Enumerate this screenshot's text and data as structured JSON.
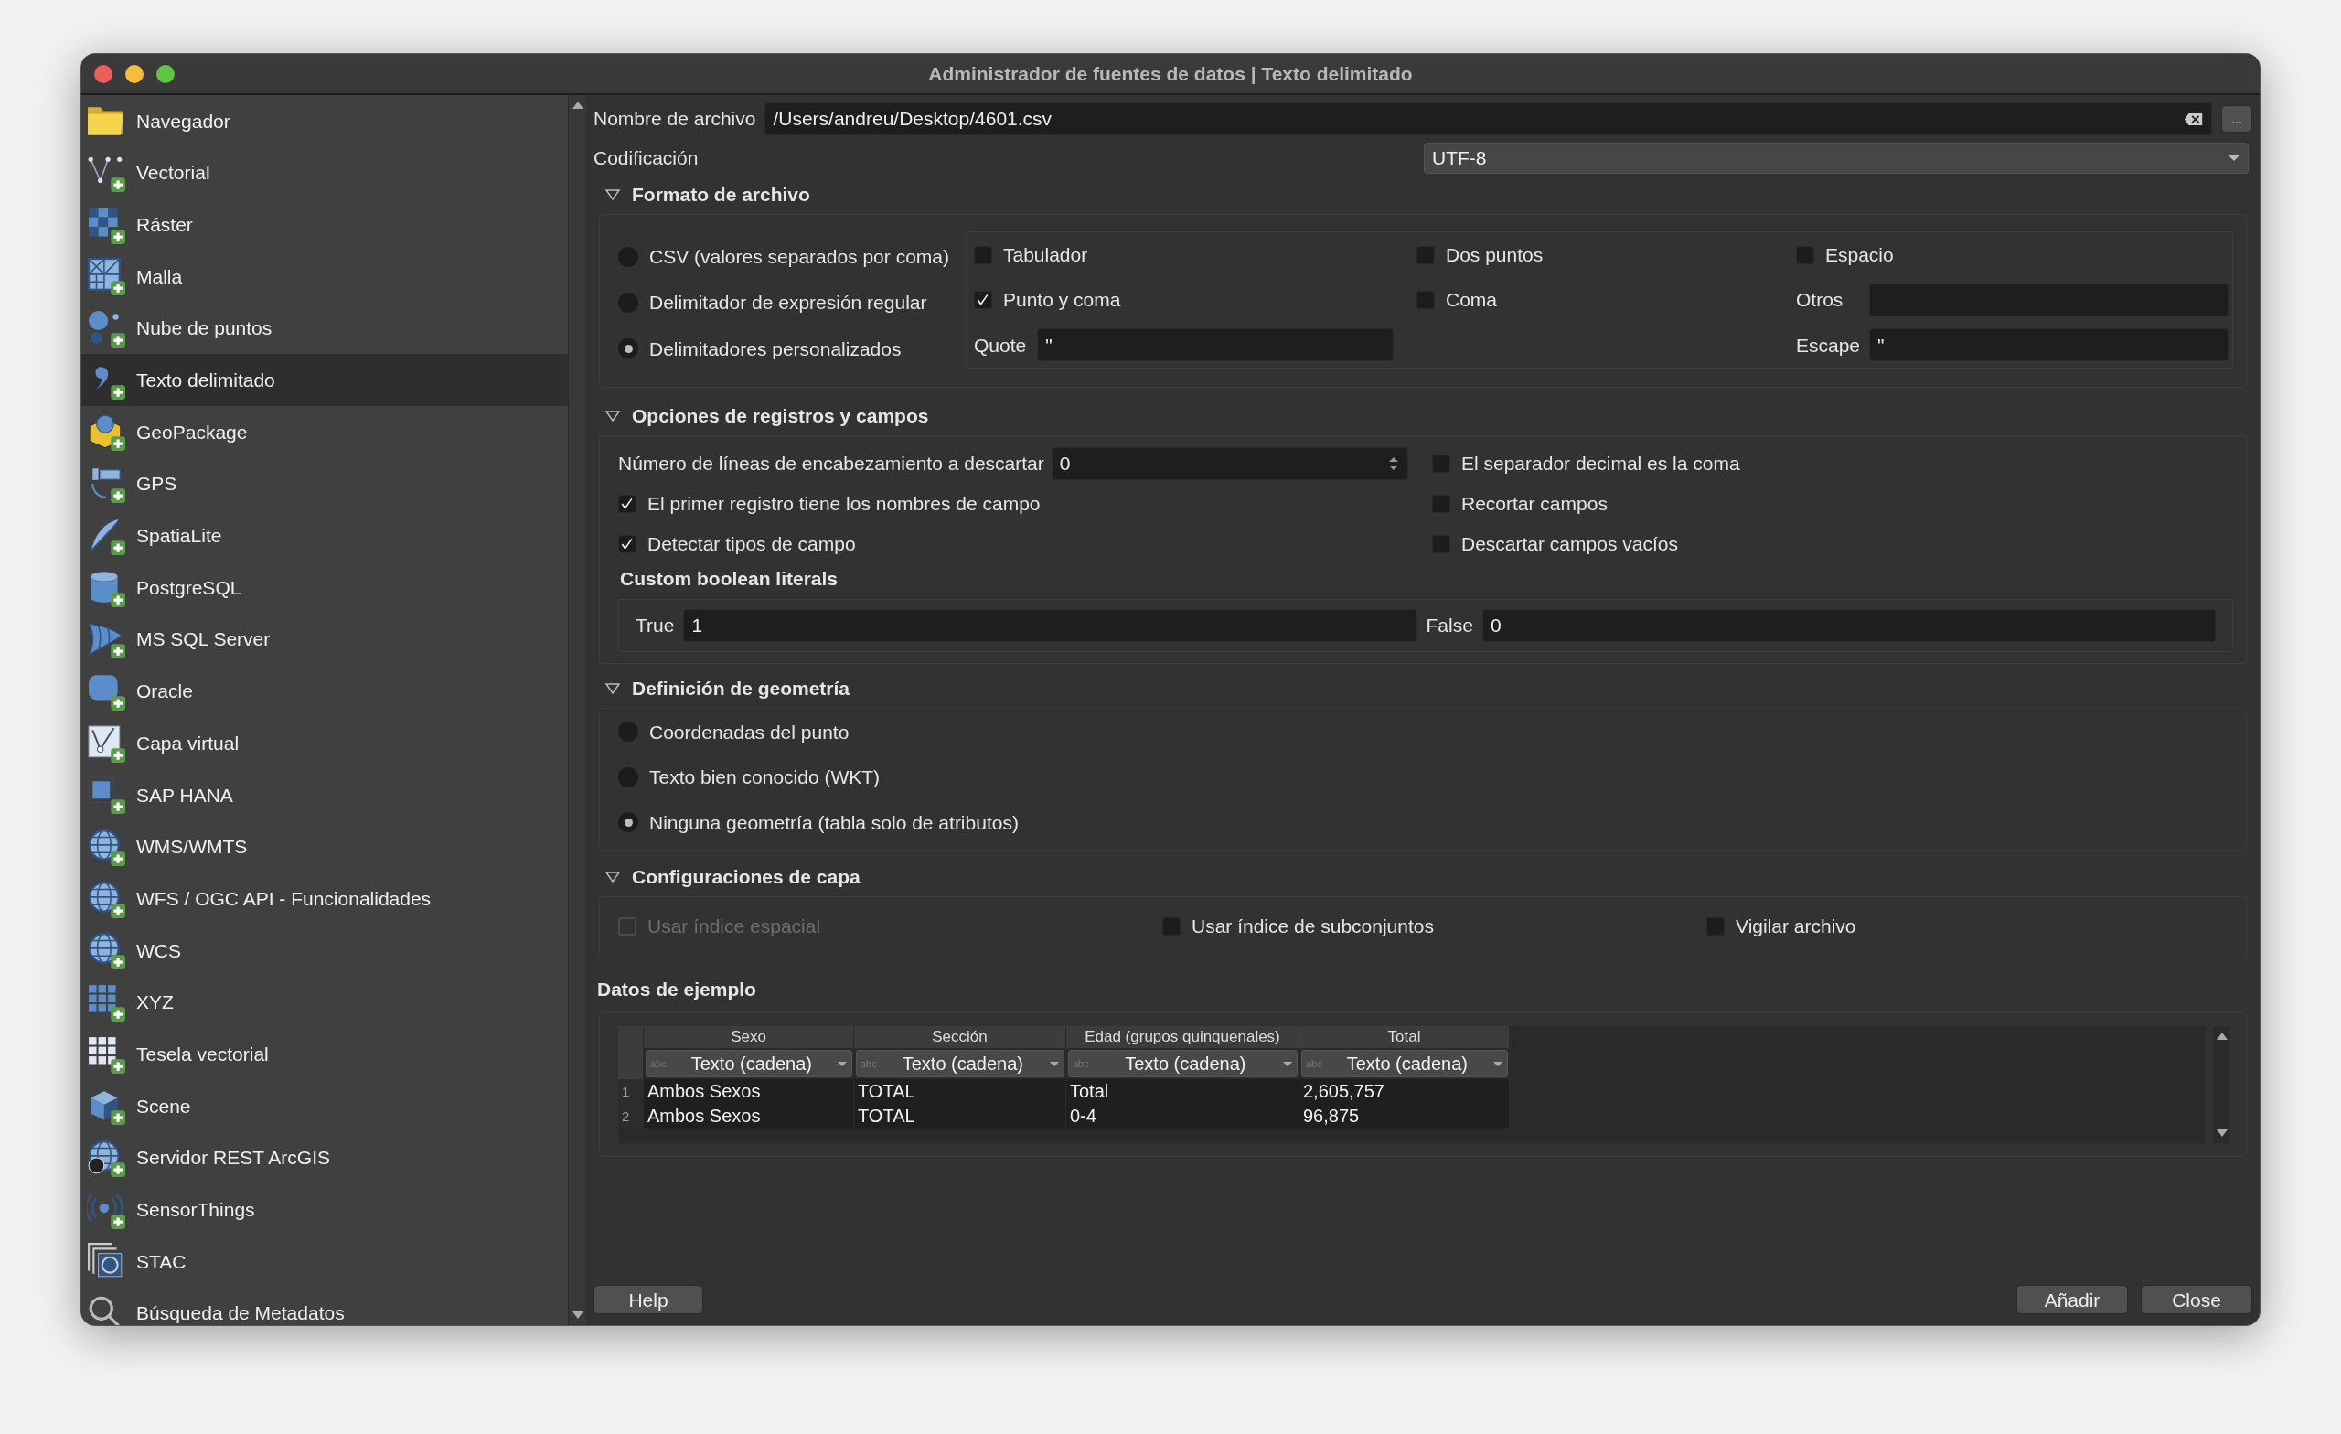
{
  "window": {
    "title": "Administrador de fuentes de datos | Texto delimitado"
  },
  "sidebar": {
    "items": [
      {
        "label": "Navegador",
        "selected": false
      },
      {
        "label": "Vectorial",
        "selected": false
      },
      {
        "label": "Ráster",
        "selected": false
      },
      {
        "label": "Malla",
        "selected": false
      },
      {
        "label": "Nube de puntos",
        "selected": false
      },
      {
        "label": "Texto delimitado",
        "selected": true
      },
      {
        "label": "GeoPackage",
        "selected": false
      },
      {
        "label": "GPS",
        "selected": false
      },
      {
        "label": "SpatiaLite",
        "selected": false
      },
      {
        "label": "PostgreSQL",
        "selected": false
      },
      {
        "label": "MS SQL Server",
        "selected": false
      },
      {
        "label": "Oracle",
        "selected": false
      },
      {
        "label": "Capa virtual",
        "selected": false
      },
      {
        "label": "SAP HANA",
        "selected": false
      },
      {
        "label": "WMS/WMTS",
        "selected": false
      },
      {
        "label": "WFS / OGC API - Funcionalidades",
        "selected": false
      },
      {
        "label": "WCS",
        "selected": false
      },
      {
        "label": "XYZ",
        "selected": false
      },
      {
        "label": "Tesela vectorial",
        "selected": false
      },
      {
        "label": "Scene",
        "selected": false
      },
      {
        "label": "Servidor REST ArcGIS",
        "selected": false
      },
      {
        "label": "SensorThings",
        "selected": false
      },
      {
        "label": "STAC",
        "selected": false
      },
      {
        "label": "Búsqueda de Metadatos",
        "selected": false
      }
    ]
  },
  "file": {
    "label": "Nombre de archivo",
    "value": "/Users/andreu/Desktop/4601.csv",
    "browse_button": "..."
  },
  "encoding": {
    "label": "Codificación",
    "value": "UTF-8"
  },
  "file_format": {
    "title": "Formato de archivo",
    "expanded": true,
    "options": [
      {
        "label": "CSV (valores separados por coma)",
        "selected": false
      },
      {
        "label": "Delimitador de expresión regular",
        "selected": false
      },
      {
        "label": "Delimitadores personalizados",
        "selected": true
      }
    ],
    "delimiters": [
      {
        "label": "Tabulador",
        "checked": false
      },
      {
        "label": "Dos puntos",
        "checked": false
      },
      {
        "label": "Espacio",
        "checked": false
      },
      {
        "label": "Punto y coma",
        "checked": true
      },
      {
        "label": "Coma",
        "checked": false
      }
    ],
    "others": {
      "label": "Otros"
    },
    "quote": {
      "label": "Quote",
      "value": "\""
    },
    "escape": {
      "label": "Escape",
      "value": "\""
    }
  },
  "records": {
    "title": "Opciones de registros y campos",
    "expanded": true,
    "skip_lines": {
      "label": "Número de líneas de encabezamiento a descartar",
      "value": "0"
    },
    "left_options": [
      {
        "label": "El primer registro tiene los nombres de campo",
        "checked": true
      },
      {
        "label": "Detectar tipos de campo",
        "checked": true
      }
    ],
    "right_options": [
      {
        "label": "El separador decimal es la coma",
        "checked": false
      },
      {
        "label": "Recortar campos",
        "checked": false
      },
      {
        "label": "Descartar campos vacíos",
        "checked": false
      }
    ],
    "boolean_literals": {
      "title": "Custom boolean literals",
      "true_label": "True",
      "true_value": "1",
      "false_label": "False",
      "false_value": "0"
    }
  },
  "geometry": {
    "title": "Definición de geometría",
    "expanded": true,
    "options": [
      {
        "label": "Coordenadas del punto",
        "selected": false
      },
      {
        "label": "Texto bien conocido (WKT)",
        "selected": false
      },
      {
        "label": "Ninguna geometría (tabla solo de atributos)",
        "selected": true
      }
    ]
  },
  "layer_settings": {
    "title": "Configuraciones de capa",
    "expanded": true,
    "options": [
      {
        "label": "Usar índice espacial",
        "checked": false,
        "disabled": true
      },
      {
        "label": "Usar índice de subconjuntos",
        "checked": false,
        "disabled": false
      },
      {
        "label": "Vigilar archivo",
        "checked": false,
        "disabled": false
      }
    ]
  },
  "sample": {
    "title": "Datos de ejemplo",
    "columns": [
      {},
      {
        "name": "Sexo",
        "type_badge": "abc",
        "type": "Texto (cadena)"
      },
      {
        "name": "Sección",
        "type_badge": "abc",
        "type": "Texto (cadena)"
      },
      {
        "name": "Edad (grupos quinquenales)",
        "type_badge": "abc",
        "type": "Texto (cadena)"
      },
      {
        "name": "Total",
        "type_badge": "abc",
        "type": "Texto (cadena)"
      }
    ],
    "rows": [
      [
        "1",
        "Ambos Sexos",
        "TOTAL",
        "Total",
        "2,605,757"
      ],
      [
        "2",
        "Ambos Sexos",
        "TOTAL",
        "0-4",
        "96,875"
      ]
    ]
  },
  "buttons": [
    {
      "label": "Help"
    },
    {
      "label": "Añadir"
    },
    {
      "label": "Close"
    }
  ]
}
